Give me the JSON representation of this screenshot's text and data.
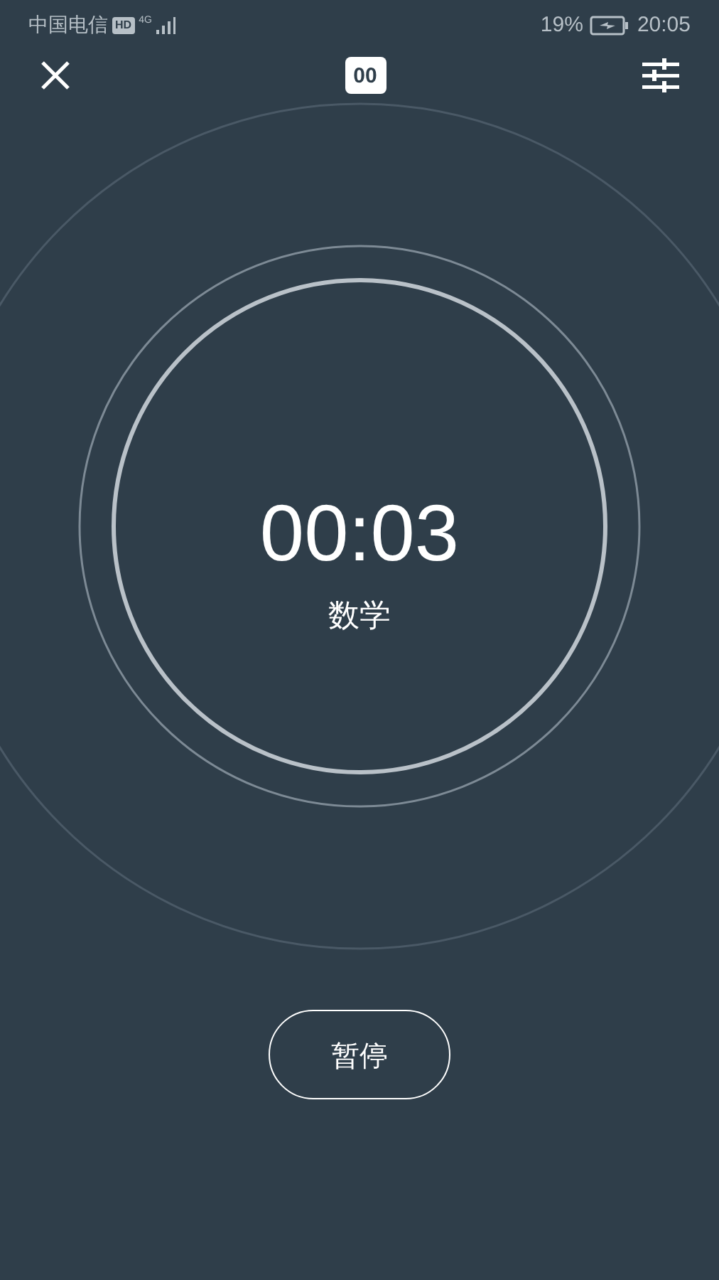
{
  "status_bar": {
    "carrier": "中国电信",
    "hd_badge": "HD",
    "network": "4G",
    "battery_percent": "19%",
    "time": "20:05"
  },
  "toolbar": {
    "clock_badge": "00"
  },
  "timer": {
    "time": "00:03",
    "subject": "数学"
  },
  "pause_button": {
    "label": "暂停"
  }
}
